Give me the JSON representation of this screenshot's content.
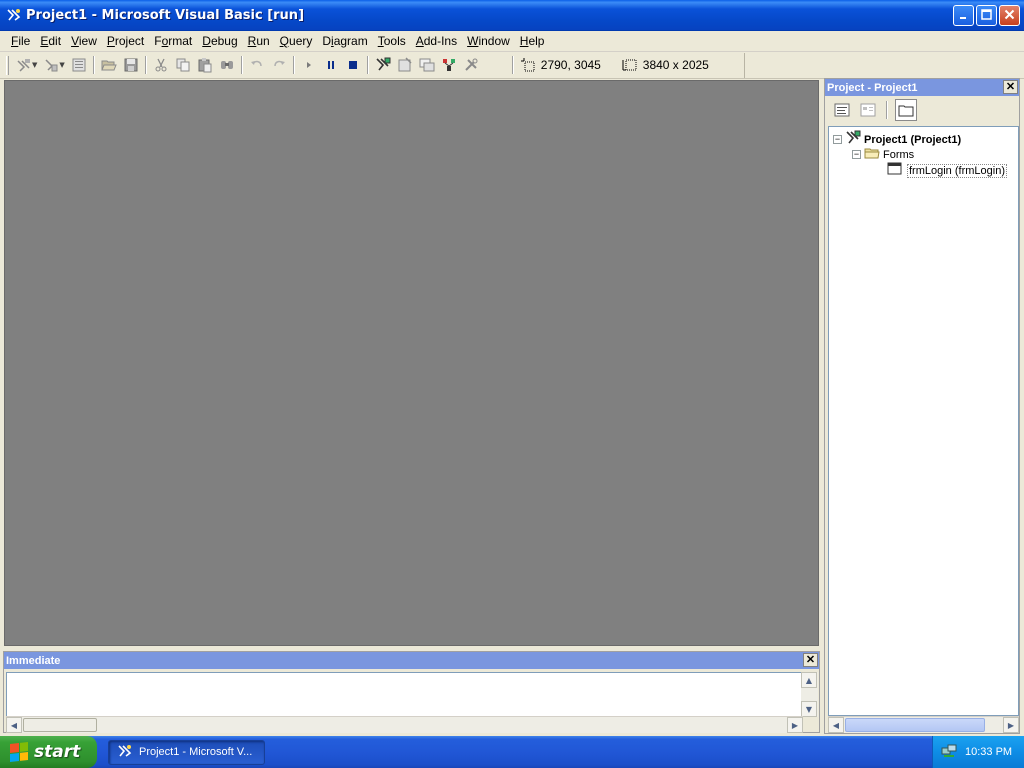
{
  "window": {
    "title": "Project1 - Microsoft Visual Basic [run]",
    "minimize_icon": "minimize-icon",
    "maximize_icon": "maximize-icon",
    "close_icon": "close-icon"
  },
  "menu": {
    "items": [
      {
        "label": "File",
        "accel": "F"
      },
      {
        "label": "Edit",
        "accel": "E"
      },
      {
        "label": "View",
        "accel": "V"
      },
      {
        "label": "Project",
        "accel": "P"
      },
      {
        "label": "Format",
        "accel": "o"
      },
      {
        "label": "Debug",
        "accel": "D"
      },
      {
        "label": "Run",
        "accel": "R"
      },
      {
        "label": "Query",
        "accel": "Q"
      },
      {
        "label": "Diagram",
        "accel": "i"
      },
      {
        "label": "Tools",
        "accel": "T"
      },
      {
        "label": "Add-Ins",
        "accel": "A"
      },
      {
        "label": "Window",
        "accel": "W"
      },
      {
        "label": "Help",
        "accel": "H"
      }
    ]
  },
  "toolbar": {
    "position": "2790, 3045",
    "size": "3840 x 2025",
    "colors": {
      "pause": "#0A2D8C",
      "stop": "#0A2D8C",
      "run": "#7A7A7A"
    }
  },
  "project_panel": {
    "title": "Project - Project1",
    "tree": {
      "root": "Project1 (Project1)",
      "folder": "Forms",
      "item": "frmLogin (frmLogin)"
    }
  },
  "immediate": {
    "title": "Immediate",
    "content": ""
  },
  "taskbar": {
    "start_label": "start",
    "task_label": "Project1 - Microsoft V...",
    "clock": "10:33 PM"
  }
}
